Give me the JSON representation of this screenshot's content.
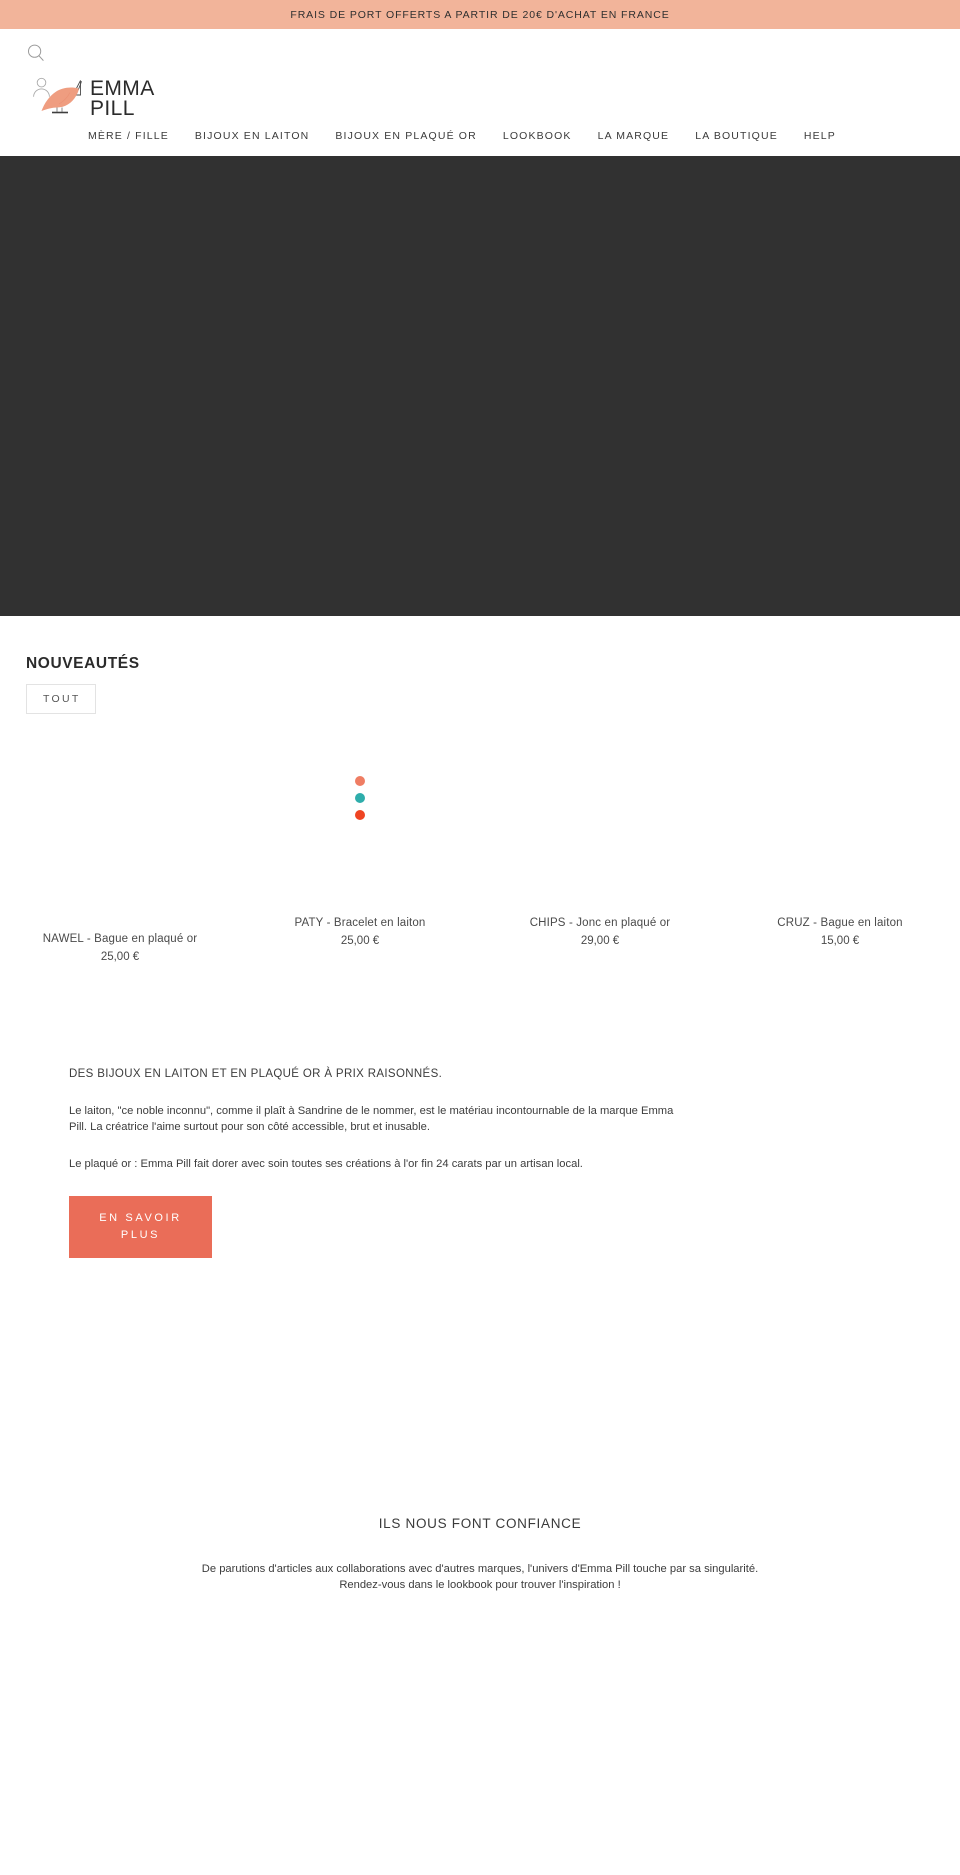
{
  "announcement": {
    "text": "FRAIS DE PORT OFFERTS A PARTIR DE 20€ D'ACHAT EN FRANCE"
  },
  "header": {
    "brand_name": "EMMA\nPILL",
    "search_icon": "search-icon",
    "account_icon": "account-icon",
    "logo_icon": "bird-logo-icon",
    "nav": [
      {
        "label": "MÈRE / FILLE"
      },
      {
        "label": "BIJOUX EN LAITON"
      },
      {
        "label": "BIJOUX EN PLAQUÉ OR"
      },
      {
        "label": "LOOKBOOK"
      },
      {
        "label": "LA MARQUE"
      },
      {
        "label": "LA BOUTIQUE"
      },
      {
        "label": "HELP"
      }
    ]
  },
  "new_section": {
    "heading": "NOUVEAUTÉS",
    "filter_label": "TOUT",
    "products": [
      {
        "title": "NAWEL - Bague en plaqué or",
        "price": "25,00 €",
        "swatches": []
      },
      {
        "title": "PATY - Bracelet en laiton",
        "price": "25,00 €",
        "swatches": [
          "#ef7d63",
          "#2eadab",
          "#ef4423"
        ]
      },
      {
        "title": "CHIPS - Jonc en plaqué or",
        "price": "29,00 €",
        "swatches": []
      },
      {
        "title": "CRUZ - Bague en laiton",
        "price": "15,00 €",
        "swatches": []
      }
    ]
  },
  "about": {
    "title": "DES BIJOUX EN LAITON ET EN PLAQUÉ OR À PRIX RAISONNÉS.",
    "paragraph_1": "Le laiton, \"ce noble inconnu\", comme il plaît à Sandrine de le nommer, est le matériau incontournable de la marque Emma Pill. La créatrice l'aime surtout pour son côté accessible, brut et inusable.",
    "paragraph_2": "Le plaqué or : Emma Pill fait dorer avec soin toutes ses créations à l'or fin 24 carats par un artisan local.",
    "cta_label": "EN SAVOIR PLUS"
  },
  "trust": {
    "title": "ILS NOUS FONT CONFIANCE",
    "subtitle": "De parutions d'articles aux collaborations avec d'autres marques, l'univers d'Emma Pill touche par sa singularité. Rendez-vous dans le lookbook pour trouver l'inspiration !"
  },
  "colors": {
    "announcement_bg": "#f2b49a",
    "hero_bg": "#313131",
    "cta_bg": "#ea6d58",
    "logo_fill": "#ef9d80"
  }
}
